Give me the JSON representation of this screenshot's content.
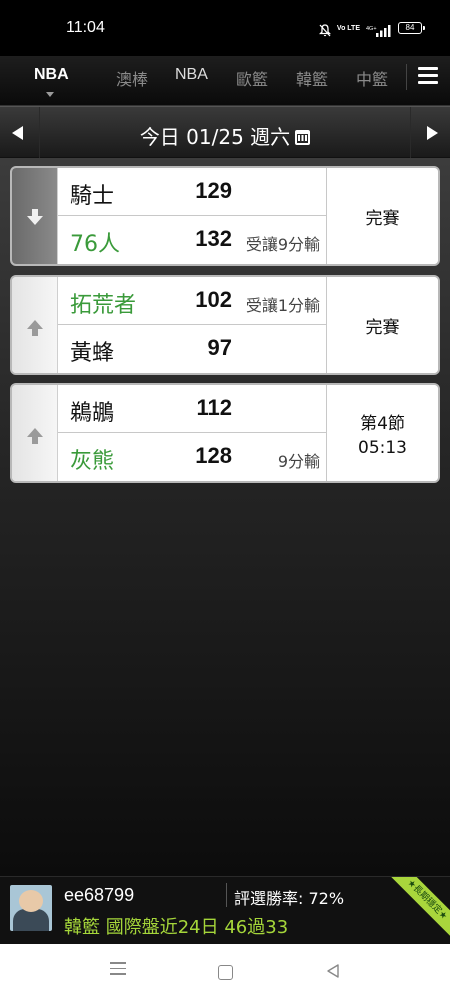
{
  "status_bar": {
    "time": "11:04",
    "volte": "Vo LTE",
    "network": "4G+",
    "battery": "84"
  },
  "league_tabs": [
    {
      "label": "NBA",
      "active": true
    },
    {
      "label": "澳棒",
      "active": false
    },
    {
      "label": "NBA",
      "active": false
    },
    {
      "label": "歐籃",
      "active": false
    },
    {
      "label": "韓籃",
      "active": false
    },
    {
      "label": "中籃",
      "active": false
    }
  ],
  "date_bar": {
    "label": "今日 01/25 週六"
  },
  "games": [
    {
      "arrow": "down",
      "top_team": {
        "name": "騎士",
        "score": "129",
        "note": "",
        "color": "#111111"
      },
      "bottom_team": {
        "name": "76人",
        "score": "132",
        "note": "受讓9分輸",
        "color": "#3a9a3a"
      },
      "status": [
        "完賽"
      ]
    },
    {
      "arrow": "up",
      "top_team": {
        "name": "拓荒者",
        "score": "102",
        "note": "受讓1分輸",
        "color": "#3a9a3a"
      },
      "bottom_team": {
        "name": "黃蜂",
        "score": "97",
        "note": "",
        "color": "#111111"
      },
      "status": [
        "完賽"
      ]
    },
    {
      "arrow": "up",
      "top_team": {
        "name": "鵜鶘",
        "score": "112",
        "note": "",
        "color": "#111111"
      },
      "bottom_team": {
        "name": "灰熊",
        "score": "128",
        "note": "9分輸",
        "color": "#3a9a3a"
      },
      "status": [
        "第4節",
        "05:13"
      ]
    }
  ],
  "user_panel": {
    "username": "ee68799",
    "win_rate": "評選勝率: 72%",
    "record": "韓籃 國際盤近24日 46過33",
    "ribbon": "★長期穩定★",
    "accent": "#a5d63a"
  },
  "icons": {
    "menu": "hamburger-menu-icon",
    "prev": "left-arrow-icon",
    "next": "right-arrow-icon",
    "calendar": "calendar-icon",
    "trend_up": "up-arrow-icon",
    "trend_down": "down-arrow-icon"
  }
}
